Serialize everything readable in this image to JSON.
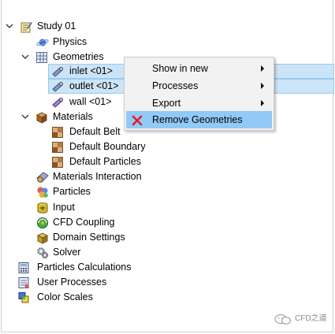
{
  "tree": {
    "study": "Study 01",
    "physics": "Physics",
    "geometries": "Geometries",
    "inlet": "inlet <01>",
    "outlet": "outlet <01>",
    "wall": "wall <01>",
    "materials": "Materials",
    "default_belt": "Default Belt",
    "default_boundary": "Default Boundary",
    "default_particles": "Default Particles",
    "materials_interaction": "Materials Interaction",
    "particles": "Particles",
    "input": "Input",
    "cfd_coupling": "CFD Coupling",
    "domain_settings": "Domain Settings",
    "solver": "Solver",
    "particles_calculations": "Particles Calculations",
    "user_processes": "User Processes",
    "color_scales": "Color Scales"
  },
  "context_menu": {
    "show_in_new": "Show in new",
    "processes": "Processes",
    "export": "Export",
    "remove_geometries": "Remove Geometries"
  },
  "watermark": "CFD之道",
  "colors": {
    "selection_fill": "#cce4f7",
    "selection_border": "#99c9ef",
    "menu_highlight": "#91c9f7",
    "remove_icon": "#e02020"
  }
}
